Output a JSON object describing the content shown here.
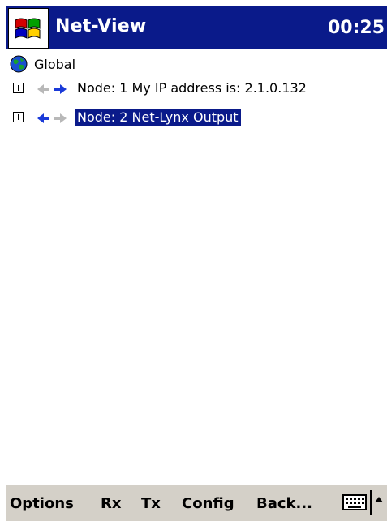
{
  "titlebar": {
    "app_title": "Net-View",
    "clock": "00:25",
    "colors": {
      "background": "#0a1a8a",
      "text": "#ffffff"
    }
  },
  "tree": {
    "root": {
      "label": "Global",
      "icon": "globe-icon"
    },
    "nodes": [
      {
        "label": "Node: 1 My IP address is: 2.1.0.132",
        "selected": false,
        "icon": "network-arrows-icon"
      },
      {
        "label": "Node: 2 Net-Lynx Output",
        "selected": true,
        "icon": "network-arrows-icon"
      }
    ],
    "colors": {
      "selection": "#0a1a8a"
    }
  },
  "menubar": {
    "items": [
      "Options",
      "Rx",
      "Tx",
      "Config",
      "Back..."
    ],
    "keyboard_icon": "keyboard-icon",
    "sip_icon": "up-arrow-icon",
    "colors": {
      "background": "#d4d0c8"
    }
  }
}
